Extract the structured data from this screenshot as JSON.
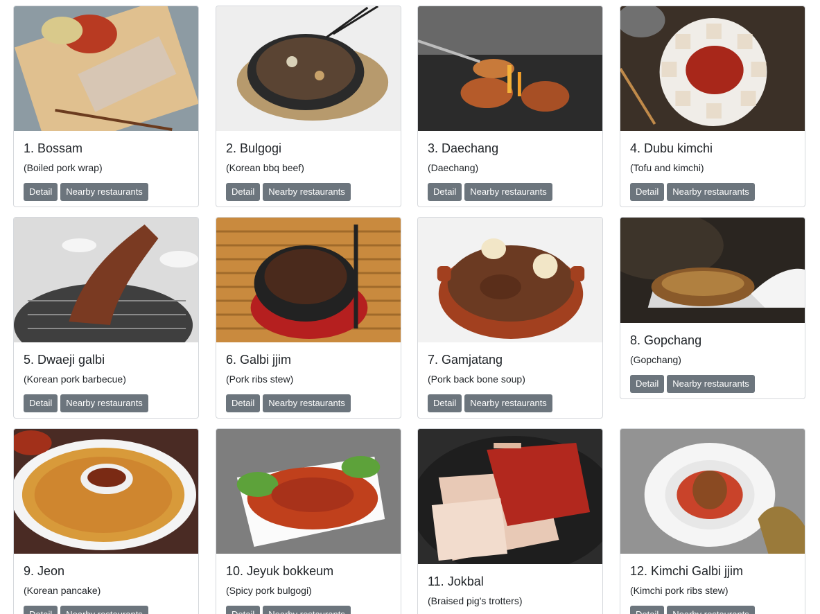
{
  "buttons": {
    "detail": "Detail",
    "nearby": "Nearby restaurants"
  },
  "dishes": [
    {
      "title": "1. Bossam",
      "subtitle": "(Boiled pork wrap)"
    },
    {
      "title": "2. Bulgogi",
      "subtitle": "(Korean bbq beef)"
    },
    {
      "title": "3. Daechang",
      "subtitle": "(Daechang)"
    },
    {
      "title": "4. Dubu kimchi",
      "subtitle": "(Tofu and kimchi)"
    },
    {
      "title": "5. Dwaeji galbi",
      "subtitle": "(Korean pork barbecue)"
    },
    {
      "title": "6. Galbi jjim",
      "subtitle": "(Pork ribs stew)"
    },
    {
      "title": "7. Gamjatang",
      "subtitle": "(Pork back bone soup)"
    },
    {
      "title": "8. Gopchang",
      "subtitle": "(Gopchang)"
    },
    {
      "title": "9. Jeon",
      "subtitle": "(Korean pancake)"
    },
    {
      "title": "10. Jeyuk bokkeum",
      "subtitle": "(Spicy pork bulgogi)"
    },
    {
      "title": "11. Jokbal",
      "subtitle": "(Braised pig's trotters)"
    },
    {
      "title": "12. Kimchi Galbi jjim",
      "subtitle": "(Kimchi pork ribs stew)"
    }
  ]
}
